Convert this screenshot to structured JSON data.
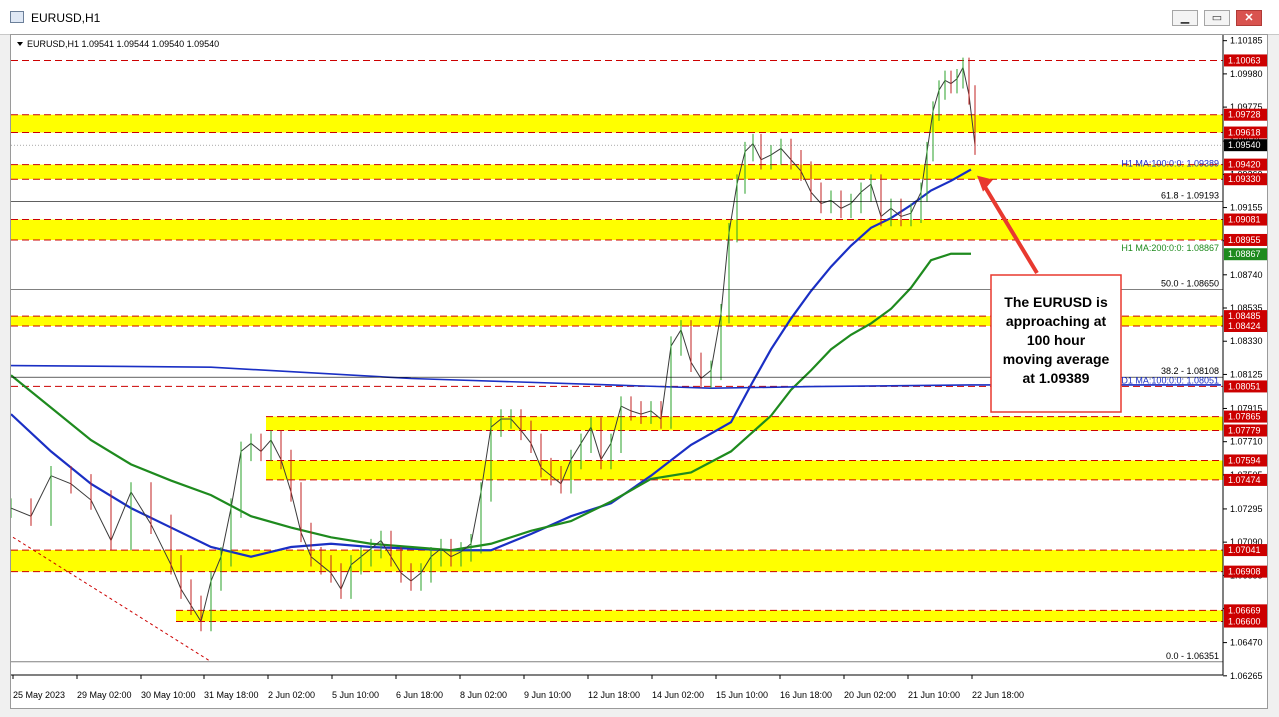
{
  "window": {
    "title": "EURUSD,H1",
    "buttons": {
      "minimize": "▁",
      "restore": "▭",
      "close": "✕"
    }
  },
  "chart": {
    "symbol_line": "EURUSD,H1  1.09541 1.09544 1.09540 1.09540",
    "colors": {
      "zone": "#ffff00",
      "resistance": "#cc0000",
      "ma100": "#1a2fc4",
      "ma200": "#1e8a1e",
      "d1ma": "#1a2fc4",
      "candle_up": "#2aa02a",
      "candle_down": "#c02020",
      "arrow": "#e8392f",
      "current": "#000000"
    }
  },
  "chart_data": {
    "type": "line",
    "ylim": [
      1.0627,
      1.1022
    ],
    "x_labels": [
      "25 May 2023",
      "29 May 02:00",
      "30 May 10:00",
      "31 May 18:00",
      "2 Jun 02:00",
      "5 Jun 10:00",
      "6 Jun 18:00",
      "8 Jun 02:00",
      "9 Jun 10:00",
      "12 Jun 18:00",
      "14 Jun 02:00",
      "15 Jun 10:00",
      "16 Jun 18:00",
      "20 Jun 02:00",
      "21 Jun 10:00",
      "22 Jun 18:00"
    ],
    "y_ticks": [
      "1.10185",
      "1.09980",
      "1.09775",
      "1.09565",
      "1.09360",
      "1.09155",
      "1.08950",
      "1.08740",
      "1.08535",
      "1.08330",
      "1.08125",
      "1.07915",
      "1.07710",
      "1.07505",
      "1.07295",
      "1.07090",
      "1.06885",
      "1.06680",
      "1.06470",
      "1.06265"
    ],
    "zones": [
      [
        1.09728,
        1.09618
      ],
      [
        1.0942,
        1.0933
      ],
      [
        1.09081,
        1.08955
      ],
      [
        1.08485,
        1.08424
      ],
      [
        1.07865,
        1.07779
      ],
      [
        1.07594,
        1.07474
      ],
      [
        1.07041,
        1.06908
      ],
      [
        1.06669,
        1.066
      ]
    ],
    "price_labels": [
      "1.10063",
      "1.09728",
      "1.09618",
      "1.09540",
      "1.09420",
      "1.09330",
      "1.09081",
      "1.08955",
      "1.08867",
      "1.08485",
      "1.08424",
      "1.08051",
      "1.07865",
      "1.07779",
      "1.07594",
      "1.07474",
      "1.07041",
      "1.06908",
      "1.06669",
      "1.06600"
    ],
    "fib_levels": [
      {
        "label": "61.8 - 1.09193",
        "value": 1.09193
      },
      {
        "label": "50.0 - 1.08650",
        "value": 1.0865
      },
      {
        "label": "38.2 - 1.08108",
        "value": 1.08108
      },
      {
        "label": "0.0 - 1.06351",
        "value": 1.06351
      }
    ],
    "ma_labels": {
      "ma100": "H1 MA:100:0:0: 1.09389",
      "ma200": "H1 MA:200:0:0: 1.08867",
      "d1ma": "D1 MA:100:0:0: 1.08051"
    },
    "current_price": "1.09540",
    "series": [
      {
        "name": "H1 MA:100",
        "x": [
          0,
          40,
          80,
          120,
          160,
          200,
          240,
          280,
          320,
          360,
          400,
          440,
          480,
          520,
          560,
          600,
          640,
          680,
          720,
          740,
          760,
          780,
          800,
          820,
          840,
          860,
          880,
          900,
          920,
          940,
          960
        ],
        "values": [
          1.0788,
          1.0765,
          1.0745,
          1.073,
          1.0718,
          1.0706,
          1.07,
          1.0706,
          1.0708,
          1.0706,
          1.0705,
          1.0704,
          1.0704,
          1.0714,
          1.0725,
          1.0733,
          1.075,
          1.0769,
          1.0783,
          1.0806,
          1.0828,
          1.0847,
          1.0864,
          1.0879,
          1.0892,
          1.0903,
          1.0909,
          1.0917,
          1.0926,
          1.0932,
          1.0939
        ]
      },
      {
        "name": "H1 MA:200",
        "x": [
          0,
          40,
          80,
          120,
          160,
          200,
          240,
          280,
          320,
          360,
          400,
          440,
          480,
          520,
          560,
          600,
          640,
          680,
          720,
          740,
          760,
          780,
          800,
          820,
          840,
          860,
          880,
          900,
          920,
          940,
          960
        ],
        "values": [
          1.0812,
          1.0792,
          1.0772,
          1.0757,
          1.0747,
          1.0738,
          1.0725,
          1.0718,
          1.0712,
          1.0708,
          1.0706,
          1.0704,
          1.0708,
          1.0716,
          1.0722,
          1.0734,
          1.0748,
          1.0752,
          1.0765,
          1.0776,
          1.0787,
          1.0803,
          1.0815,
          1.0828,
          1.0837,
          1.0844,
          1.0853,
          1.0866,
          1.0883,
          1.0887,
          1.0887
        ]
      },
      {
        "name": "D1 MA:100",
        "x": [
          0,
          200,
          400,
          600,
          700,
          800,
          960,
          1210
        ],
        "values": [
          1.0818,
          1.0817,
          1.081,
          1.0806,
          1.0804,
          1.0805,
          1.0806,
          1.0806
        ]
      },
      {
        "name": "EURUSD close",
        "x": [
          0,
          20,
          40,
          60,
          80,
          100,
          120,
          140,
          160,
          170,
          180,
          190,
          200,
          210,
          220,
          230,
          240,
          250,
          260,
          270,
          280,
          290,
          300,
          310,
          320,
          330,
          340,
          350,
          360,
          370,
          380,
          390,
          400,
          410,
          420,
          430,
          440,
          450,
          460,
          470,
          480,
          490,
          500,
          510,
          520,
          530,
          540,
          550,
          560,
          570,
          580,
          590,
          600,
          610,
          620,
          630,
          640,
          650,
          660,
          670,
          680,
          690,
          700,
          710,
          718,
          726,
          734,
          742,
          750,
          760,
          770,
          780,
          790,
          800,
          810,
          820,
          830,
          840,
          850,
          860,
          870,
          880,
          890,
          900,
          910,
          916,
          922,
          928,
          934,
          940,
          946,
          952,
          958,
          964
        ],
        "values": [
          1.073,
          1.0725,
          1.075,
          1.0745,
          1.0735,
          1.071,
          1.074,
          1.072,
          1.0695,
          1.068,
          1.067,
          1.066,
          1.0685,
          1.07,
          1.073,
          1.0765,
          1.077,
          1.0765,
          1.0772,
          1.076,
          1.074,
          1.0715,
          1.07,
          1.0695,
          1.069,
          1.068,
          1.0695,
          1.07,
          1.0705,
          1.071,
          1.07,
          1.069,
          1.0685,
          1.069,
          1.07,
          1.0705,
          1.07,
          1.0703,
          1.0708,
          1.074,
          1.078,
          1.0785,
          1.0785,
          1.0778,
          1.077,
          1.0755,
          1.075,
          1.0745,
          1.076,
          1.077,
          1.078,
          1.076,
          1.077,
          1.0793,
          1.079,
          1.0788,
          1.079,
          1.0785,
          1.083,
          1.084,
          1.082,
          1.081,
          1.0815,
          1.085,
          1.09,
          1.093,
          1.095,
          1.0955,
          1.0945,
          1.0948,
          1.0952,
          1.0945,
          1.0938,
          1.0925,
          1.0918,
          1.092,
          1.0915,
          1.0918,
          1.0925,
          1.093,
          1.091,
          1.0915,
          1.091,
          1.0912,
          1.0925,
          1.095,
          1.0975,
          1.0988,
          1.0994,
          1.0992,
          1.0995,
          1.1002,
          1.0985,
          1.0954
        ]
      }
    ],
    "callout": {
      "lines": [
        "The EURUSD is",
        "approaching at",
        "100 hour",
        "moving average",
        "at 1.09389"
      ]
    }
  }
}
